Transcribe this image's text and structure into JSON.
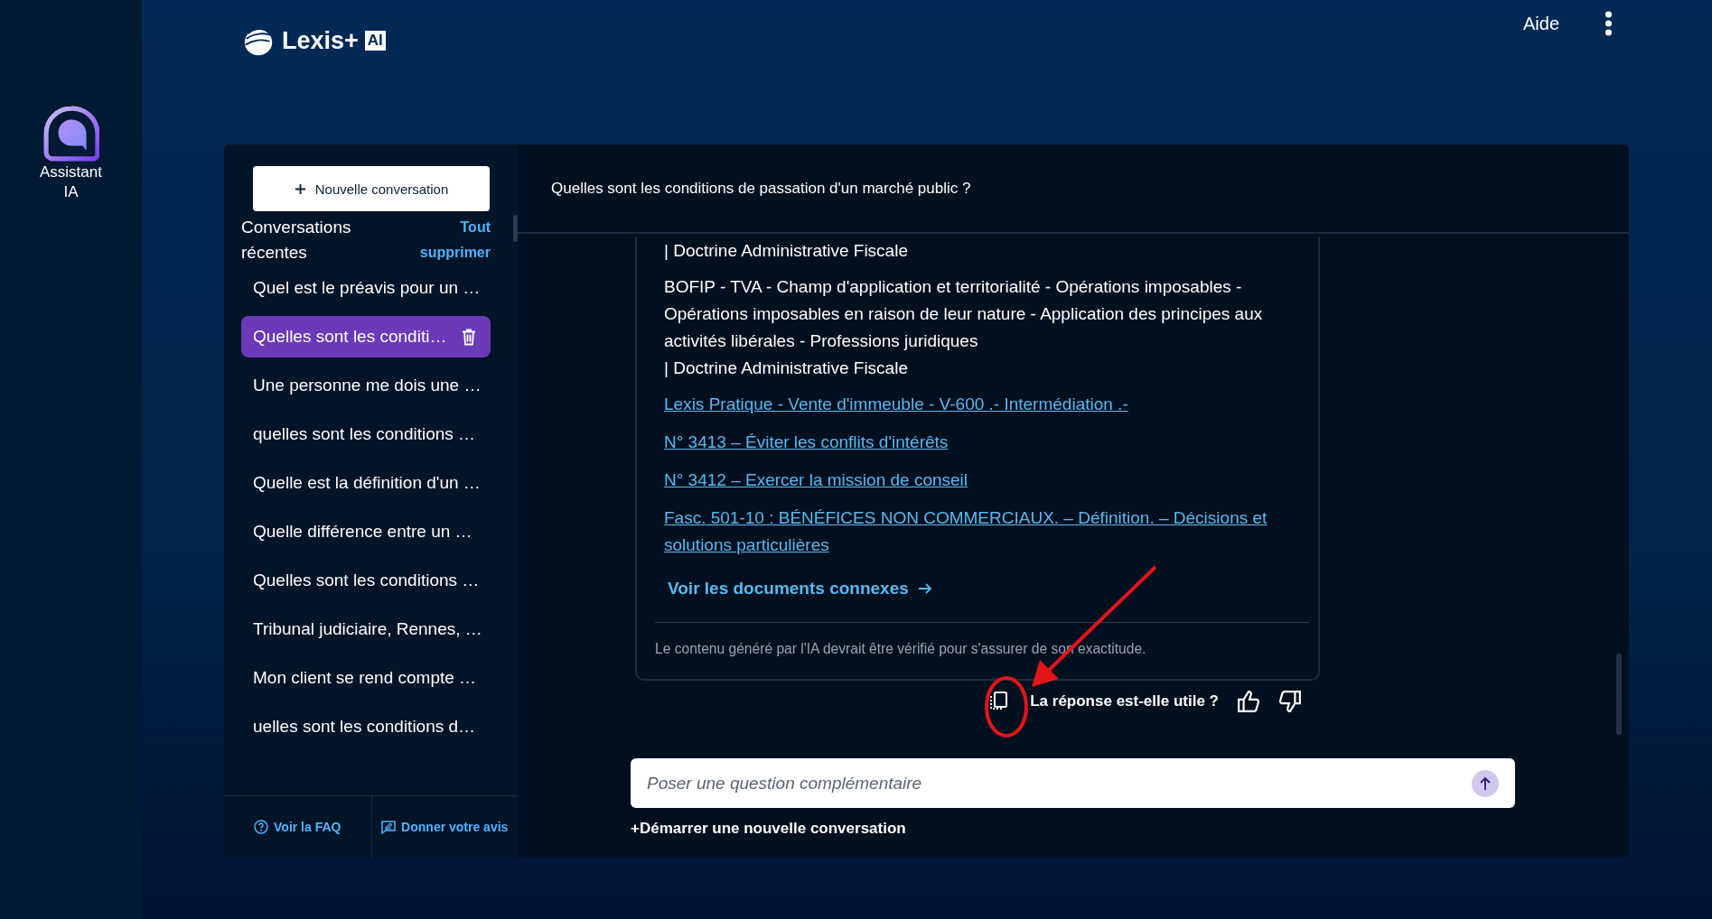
{
  "brand": {
    "name": "Lexis+",
    "badge": "AI"
  },
  "rail": {
    "label": "Assistant IA"
  },
  "topbar": {
    "help": "Aide"
  },
  "sidebar": {
    "new_button": "Nouvelle conversation",
    "heading": "Conversations récentes",
    "clear_link": "Tout supprimer",
    "items": [
      {
        "label": "Quel est le préavis pour un …",
        "selected": false
      },
      {
        "label": "Quelles sont les conditi…",
        "selected": true
      },
      {
        "label": "Une personne me dois une …",
        "selected": false
      },
      {
        "label": "quelles sont les conditions …",
        "selected": false
      },
      {
        "label": "Quelle est la définition d'un …",
        "selected": false
      },
      {
        "label": "Quelle différence entre un …",
        "selected": false
      },
      {
        "label": "Quelles sont les conditions …",
        "selected": false
      },
      {
        "label": "Tribunal judiciaire, Rennes, …",
        "selected": false
      },
      {
        "label": "Mon client se rend compte …",
        "selected": false
      },
      {
        "label": "uelles sont les conditions d…",
        "selected": false
      }
    ],
    "footer": [
      {
        "label": "Voir la FAQ",
        "kind": "faq"
      },
      {
        "label": "Donner votre avis",
        "kind": "feedback"
      }
    ]
  },
  "conversation": {
    "question": "Quelles sont les conditions de passation d'un marché public ?",
    "blocks": [
      {
        "kind": "text",
        "text": "| Doctrine Administrative Fiscale"
      },
      {
        "kind": "text",
        "text": "BOFIP - TVA - Champ d'application et territorialité - Opérations imposables - Opérations imposables en raison de leur nature - Application des principes aux activités libérales - Professions juridiques",
        "source": "| Doctrine Administrative Fiscale"
      },
      {
        "kind": "link",
        "text": "Lexis Pratique - Vente d'immeuble - V-600 .- Intermédiation .-"
      },
      {
        "kind": "link",
        "text": "N° 3413 – Éviter les conflits d'intérêts"
      },
      {
        "kind": "link",
        "text": "N° 3412 – Exercer la mission de conseil"
      },
      {
        "kind": "link",
        "text": "Fasc. 501-10 : BÉNÉFICES NON COMMERCIAUX. – Définition. – Décisions et solutions particulières"
      }
    ],
    "related_link": "Voir les documents connexes",
    "disclaimer": "Le contenu généré par l'IA devrait être vérifié pour s'assurer de son exactitude.",
    "feedback_prompt": "La réponse est-elle utile ?",
    "input": {
      "placeholder": "Poser une question complémentaire"
    },
    "new_conversation": "+Démarrer une nouvelle conversation"
  }
}
